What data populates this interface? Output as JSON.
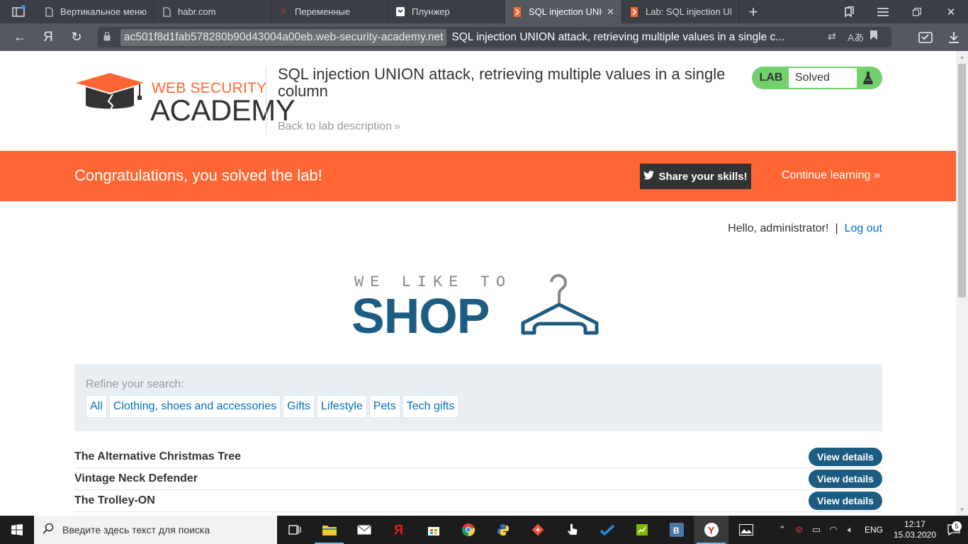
{
  "browser": {
    "tabs": [
      {
        "title": "Вертикальное меню"
      },
      {
        "title": "habr.com"
      },
      {
        "title": "Переменные"
      },
      {
        "title": "Плунжер"
      },
      {
        "title": "SQL injection UNIO"
      },
      {
        "title": "Lab: SQL injection UN"
      }
    ],
    "url_host": "ac501f8d1fab578280b90d43004a00eb.web-security-academy.net",
    "url_title": "SQL injection UNION attack, retrieving multiple values in a single c...",
    "brand_letter": "Я"
  },
  "academy": {
    "logo_top": "WEB SECURITY",
    "logo_bottom": "ACADEMY",
    "lab_title": "SQL injection UNION attack, retrieving multiple values in a single column",
    "back_link": "Back to lab description",
    "status_label": "LAB",
    "status_value": "Solved"
  },
  "banner": {
    "message": "Congratulations, you solved the lab!",
    "share": "Share your skills!",
    "continue": "Continue learning"
  },
  "account": {
    "greeting": "Hello, administrator!",
    "separator": "|",
    "logout": "Log out"
  },
  "shop": {
    "tagline": "WE LIKE TO",
    "word": "SHOP"
  },
  "filters": {
    "label": "Refine your search:",
    "categories": [
      "All",
      "Clothing, shoes and accessories",
      "Gifts",
      "Lifestyle",
      "Pets",
      "Tech gifts"
    ]
  },
  "products": [
    {
      "name": "The Alternative Christmas Tree",
      "action": "View details"
    },
    {
      "name": "Vintage Neck Defender",
      "action": "View details"
    },
    {
      "name": "The Trolley-ON",
      "action": "View details"
    }
  ],
  "taskbar": {
    "search_placeholder": "Введите здесь текст для поиска",
    "lang": "ENG",
    "time": "12:17",
    "date": "15.03.2020",
    "notifications": "5"
  },
  "colors": {
    "accent_orange": "#ff6633",
    "shop_blue": "#1d5c82",
    "link_blue": "#0071bc",
    "solved_green": "#70d16d"
  }
}
